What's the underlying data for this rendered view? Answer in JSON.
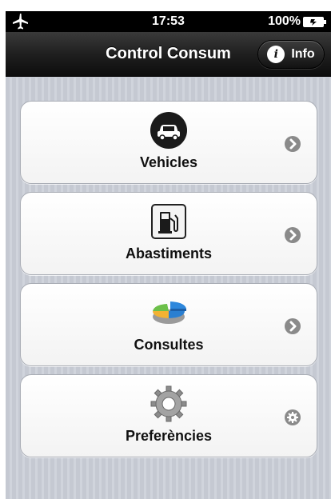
{
  "status_bar": {
    "time": "17:53",
    "battery_percent": "100%",
    "icons": [
      "airplane-icon",
      "battery-charging-icon"
    ]
  },
  "nav": {
    "title": "Control Consum",
    "info_button_label": "Info",
    "info_icon_glyph": "i"
  },
  "menu": {
    "items": [
      {
        "label": "Vehicles",
        "icon": "car-icon",
        "accessory": "chevron-right-icon"
      },
      {
        "label": "Abastiments",
        "icon": "fuel-pump-icon",
        "accessory": "chevron-right-icon"
      },
      {
        "label": "Consultes",
        "icon": "pie-chart-icon",
        "accessory": "chevron-right-icon"
      },
      {
        "label": "Preferències",
        "icon": "gear-icon",
        "accessory": "gear-small-icon"
      }
    ]
  },
  "colors": {
    "nav_bar": "#1f1f1f",
    "background": "#c9cdd6",
    "accessory_gray": "#8a8a8a"
  }
}
